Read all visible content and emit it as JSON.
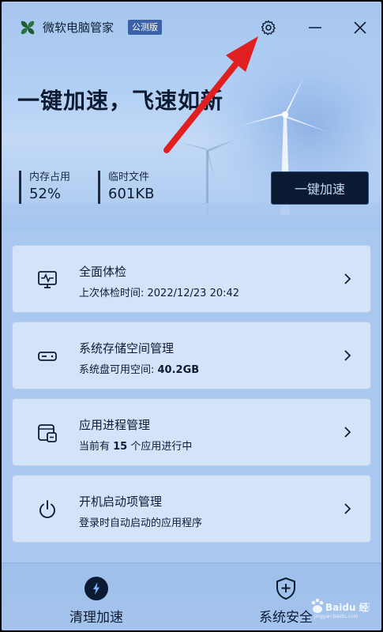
{
  "titlebar": {
    "app_name": "微软电脑管家",
    "edition": "公测版",
    "settings_icon": "gear-icon",
    "minimize_icon": "minimize-icon",
    "close_icon": "close-icon"
  },
  "hero": {
    "headline": "一键加速，飞速如新",
    "stats": [
      {
        "label": "内存占用",
        "value": "52%"
      },
      {
        "label": "临时文件",
        "value": "601KB"
      }
    ],
    "boost_button": "一键加速"
  },
  "cards": [
    {
      "icon": "health-monitor-icon",
      "title": "全面体检",
      "sub_prefix": "上次体检时间: 2022/12/23 20:42",
      "sub_bold": "",
      "sub_suffix": ""
    },
    {
      "icon": "storage-drive-icon",
      "title": "系统存储空间管理",
      "sub_prefix": "系统盘可用空间:  ",
      "sub_bold": "40.2GB",
      "sub_suffix": ""
    },
    {
      "icon": "app-process-icon",
      "title": "应用进程管理",
      "sub_prefix": "当前有 ",
      "sub_bold": "15",
      "sub_suffix": " 个应用进行中"
    },
    {
      "icon": "power-icon",
      "title": "开机启动项管理",
      "sub_prefix": "登录时自动启动的应用程序",
      "sub_bold": "",
      "sub_suffix": ""
    }
  ],
  "bottom_nav": [
    {
      "icon": "lightning-icon",
      "label": "清理加速"
    },
    {
      "icon": "shield-plus-icon",
      "label": "系统安全"
    }
  ],
  "watermark": {
    "text": "Baidu 经验",
    "sub": "jingyan.baidu.com"
  },
  "colors": {
    "accent_dark": "#0b1a33",
    "background": "#a9c8ef",
    "card": "#d3e4f9",
    "annotation_arrow": "#e02020"
  }
}
